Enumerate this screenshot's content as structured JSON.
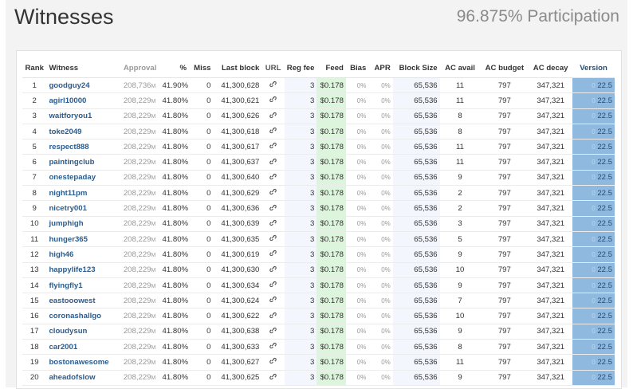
{
  "header": {
    "title": "Witnesses",
    "participation": "96.875% Participation"
  },
  "columns": {
    "rank": "Rank",
    "witness": "Witness",
    "approval": "Approval",
    "pct": "%",
    "miss": "Miss",
    "last_block": "Last block",
    "url": "URL",
    "reg_fee": "Reg fee",
    "feed": "Feed",
    "bias": "Bias",
    "apr": "APR",
    "block_size": "Block Size",
    "ac_avail": "AC avail",
    "ac_budget": "AC budget",
    "ac_decay": "AC decay",
    "version": "Version"
  },
  "url_icon": "link-icon",
  "colors": {
    "link": "#2a5c8f",
    "feed_bg": "#ddf5dc",
    "version_bg": "#8fb9de"
  },
  "rows": [
    {
      "rank": "1",
      "witness": "goodguy24",
      "approval": "208,736",
      "unit": "M",
      "pct": "41.90%",
      "miss": "0",
      "last_block": "41,300,628",
      "reg_fee": "3",
      "feed": "$0.178",
      "bias": "0%",
      "apr": "0%",
      "block_size": "65,536",
      "ac_avail": "11",
      "ac_budget": "797",
      "ac_decay": "347,321",
      "ver_pre": "0",
      "version": "22.5"
    },
    {
      "rank": "2",
      "witness": "agirl10000",
      "approval": "208,229",
      "unit": "M",
      "pct": "41.80%",
      "miss": "0",
      "last_block": "41,300,621",
      "reg_fee": "3",
      "feed": "$0.178",
      "bias": "0%",
      "apr": "0%",
      "block_size": "65,536",
      "ac_avail": "11",
      "ac_budget": "797",
      "ac_decay": "347,321",
      "ver_pre": "0",
      "version": "22.5"
    },
    {
      "rank": "3",
      "witness": "waitforyou1",
      "approval": "208,229",
      "unit": "M",
      "pct": "41.80%",
      "miss": "0",
      "last_block": "41,300,626",
      "reg_fee": "3",
      "feed": "$0.178",
      "bias": "0%",
      "apr": "0%",
      "block_size": "65,536",
      "ac_avail": "8",
      "ac_budget": "797",
      "ac_decay": "347,321",
      "ver_pre": "0",
      "version": "22.5"
    },
    {
      "rank": "4",
      "witness": "toke2049",
      "approval": "208,229",
      "unit": "M",
      "pct": "41.80%",
      "miss": "0",
      "last_block": "41,300,618",
      "reg_fee": "3",
      "feed": "$0.178",
      "bias": "0%",
      "apr": "0%",
      "block_size": "65,536",
      "ac_avail": "8",
      "ac_budget": "797",
      "ac_decay": "347,321",
      "ver_pre": "0",
      "version": "22.5"
    },
    {
      "rank": "5",
      "witness": "respect888",
      "approval": "208,229",
      "unit": "M",
      "pct": "41.80%",
      "miss": "0",
      "last_block": "41,300,617",
      "reg_fee": "3",
      "feed": "$0.178",
      "bias": "0%",
      "apr": "0%",
      "block_size": "65,536",
      "ac_avail": "11",
      "ac_budget": "797",
      "ac_decay": "347,321",
      "ver_pre": "0",
      "version": "22.5"
    },
    {
      "rank": "6",
      "witness": "paintingclub",
      "approval": "208,229",
      "unit": "M",
      "pct": "41.80%",
      "miss": "0",
      "last_block": "41,300,637",
      "reg_fee": "3",
      "feed": "$0.178",
      "bias": "0%",
      "apr": "0%",
      "block_size": "65,536",
      "ac_avail": "11",
      "ac_budget": "797",
      "ac_decay": "347,321",
      "ver_pre": "0",
      "version": "22.5"
    },
    {
      "rank": "7",
      "witness": "onestepaday",
      "approval": "208,229",
      "unit": "M",
      "pct": "41.80%",
      "miss": "0",
      "last_block": "41,300,640",
      "reg_fee": "3",
      "feed": "$0.178",
      "bias": "0%",
      "apr": "0%",
      "block_size": "65,536",
      "ac_avail": "9",
      "ac_budget": "797",
      "ac_decay": "347,321",
      "ver_pre": "0",
      "version": "22.5"
    },
    {
      "rank": "8",
      "witness": "night11pm",
      "approval": "208,229",
      "unit": "M",
      "pct": "41.80%",
      "miss": "0",
      "last_block": "41,300,629",
      "reg_fee": "3",
      "feed": "$0.178",
      "bias": "0%",
      "apr": "0%",
      "block_size": "65,536",
      "ac_avail": "2",
      "ac_budget": "797",
      "ac_decay": "347,321",
      "ver_pre": "0",
      "version": "22.5"
    },
    {
      "rank": "9",
      "witness": "nicetry001",
      "approval": "208,229",
      "unit": "M",
      "pct": "41.80%",
      "miss": "0",
      "last_block": "41,300,636",
      "reg_fee": "3",
      "feed": "$0.178",
      "bias": "0%",
      "apr": "0%",
      "block_size": "65,536",
      "ac_avail": "2",
      "ac_budget": "797",
      "ac_decay": "347,321",
      "ver_pre": "0",
      "version": "22.5"
    },
    {
      "rank": "10",
      "witness": "jumphigh",
      "approval": "208,229",
      "unit": "M",
      "pct": "41.80%",
      "miss": "0",
      "last_block": "41,300,639",
      "reg_fee": "3",
      "feed": "$0.178",
      "bias": "0%",
      "apr": "0%",
      "block_size": "65,536",
      "ac_avail": "3",
      "ac_budget": "797",
      "ac_decay": "347,321",
      "ver_pre": "0",
      "version": "22.5"
    },
    {
      "rank": "11",
      "witness": "hunger365",
      "approval": "208,229",
      "unit": "M",
      "pct": "41.80%",
      "miss": "0",
      "last_block": "41,300,635",
      "reg_fee": "3",
      "feed": "$0.178",
      "bias": "0%",
      "apr": "0%",
      "block_size": "65,536",
      "ac_avail": "5",
      "ac_budget": "797",
      "ac_decay": "347,321",
      "ver_pre": "0",
      "version": "22.5"
    },
    {
      "rank": "12",
      "witness": "high46",
      "approval": "208,229",
      "unit": "M",
      "pct": "41.80%",
      "miss": "0",
      "last_block": "41,300,619",
      "reg_fee": "3",
      "feed": "$0.178",
      "bias": "0%",
      "apr": "0%",
      "block_size": "65,536",
      "ac_avail": "9",
      "ac_budget": "797",
      "ac_decay": "347,321",
      "ver_pre": "0",
      "version": "22.5"
    },
    {
      "rank": "13",
      "witness": "happylife123",
      "approval": "208,229",
      "unit": "M",
      "pct": "41.80%",
      "miss": "0",
      "last_block": "41,300,630",
      "reg_fee": "3",
      "feed": "$0.178",
      "bias": "0%",
      "apr": "0%",
      "block_size": "65,536",
      "ac_avail": "10",
      "ac_budget": "797",
      "ac_decay": "347,321",
      "ver_pre": "0",
      "version": "22.5"
    },
    {
      "rank": "14",
      "witness": "flyingfly1",
      "approval": "208,229",
      "unit": "M",
      "pct": "41.80%",
      "miss": "0",
      "last_block": "41,300,634",
      "reg_fee": "3",
      "feed": "$0.178",
      "bias": "0%",
      "apr": "0%",
      "block_size": "65,536",
      "ac_avail": "9",
      "ac_budget": "797",
      "ac_decay": "347,321",
      "ver_pre": "0",
      "version": "22.5"
    },
    {
      "rank": "15",
      "witness": "eastooowest",
      "approval": "208,229",
      "unit": "M",
      "pct": "41.80%",
      "miss": "0",
      "last_block": "41,300,624",
      "reg_fee": "3",
      "feed": "$0.178",
      "bias": "0%",
      "apr": "0%",
      "block_size": "65,536",
      "ac_avail": "7",
      "ac_budget": "797",
      "ac_decay": "347,321",
      "ver_pre": "0",
      "version": "22.5"
    },
    {
      "rank": "16",
      "witness": "coronashallgo",
      "approval": "208,229",
      "unit": "M",
      "pct": "41.80%",
      "miss": "0",
      "last_block": "41,300,622",
      "reg_fee": "3",
      "feed": "$0.178",
      "bias": "0%",
      "apr": "0%",
      "block_size": "65,536",
      "ac_avail": "10",
      "ac_budget": "797",
      "ac_decay": "347,321",
      "ver_pre": "0",
      "version": "22.5"
    },
    {
      "rank": "17",
      "witness": "cloudysun",
      "approval": "208,229",
      "unit": "M",
      "pct": "41.80%",
      "miss": "0",
      "last_block": "41,300,638",
      "reg_fee": "3",
      "feed": "$0.178",
      "bias": "0%",
      "apr": "0%",
      "block_size": "65,536",
      "ac_avail": "9",
      "ac_budget": "797",
      "ac_decay": "347,321",
      "ver_pre": "0",
      "version": "22.5"
    },
    {
      "rank": "18",
      "witness": "car2001",
      "approval": "208,229",
      "unit": "M",
      "pct": "41.80%",
      "miss": "0",
      "last_block": "41,300,633",
      "reg_fee": "3",
      "feed": "$0.178",
      "bias": "0%",
      "apr": "0%",
      "block_size": "65,536",
      "ac_avail": "8",
      "ac_budget": "797",
      "ac_decay": "347,321",
      "ver_pre": "0",
      "version": "22.5"
    },
    {
      "rank": "19",
      "witness": "bostonawesome",
      "approval": "208,229",
      "unit": "M",
      "pct": "41.80%",
      "miss": "0",
      "last_block": "41,300,627",
      "reg_fee": "3",
      "feed": "$0.178",
      "bias": "0%",
      "apr": "0%",
      "block_size": "65,536",
      "ac_avail": "11",
      "ac_budget": "797",
      "ac_decay": "347,321",
      "ver_pre": "0",
      "version": "22.5"
    },
    {
      "rank": "20",
      "witness": "aheadofslow",
      "approval": "208,229",
      "unit": "M",
      "pct": "41.80%",
      "miss": "0",
      "last_block": "41,300,625",
      "reg_fee": "3",
      "feed": "$0.178",
      "bias": "0%",
      "apr": "0%",
      "block_size": "65,536",
      "ac_avail": "9",
      "ac_budget": "797",
      "ac_decay": "347,321",
      "ver_pre": "0",
      "version": "22.5"
    }
  ]
}
